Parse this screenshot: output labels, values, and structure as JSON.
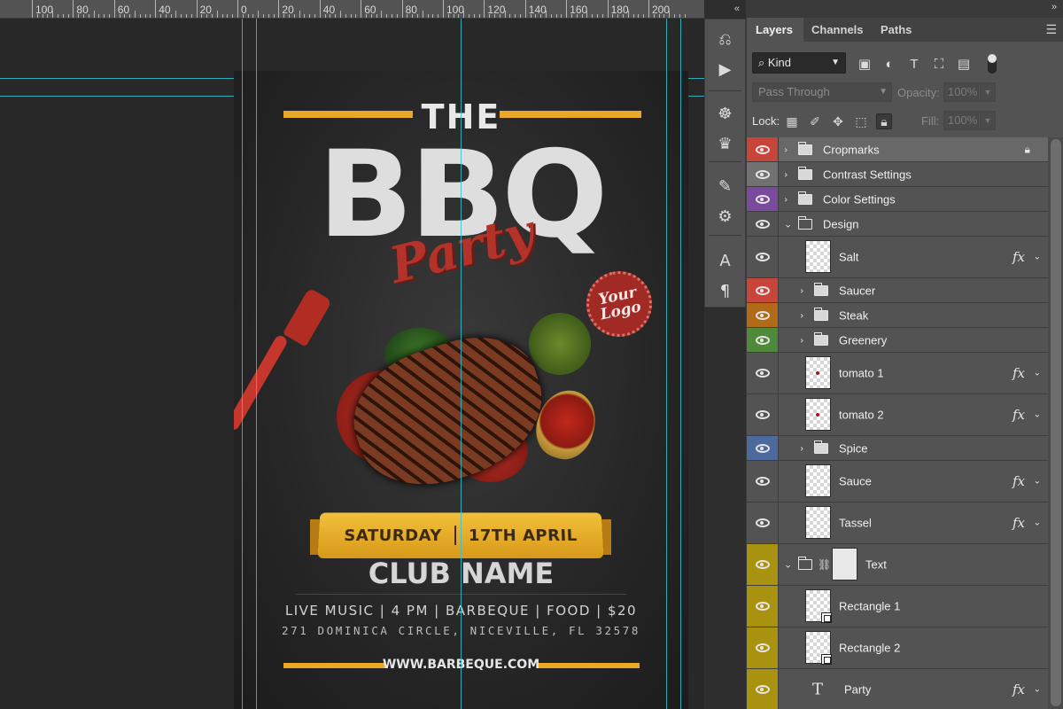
{
  "ruler": {
    "labels": [
      "100",
      "80",
      "60",
      "40",
      "20",
      "0",
      "20",
      "40",
      "60",
      "80",
      "100",
      "120",
      "140",
      "160",
      "180",
      "200"
    ]
  },
  "poster": {
    "title_top": "THE",
    "title_main": "BBQ",
    "title_script": "Party",
    "logo_line1": "Your",
    "logo_line2": "Logo",
    "ribbon_day": "SATURDAY",
    "ribbon_date": "17TH APRIL",
    "club": "CLUB NAME",
    "details": "LIVE MUSIC | 4 PM | BARBEQUE | FOOD | $20",
    "address": "271 DOMINICA CIRCLE, NICEVILLE, FL 32578",
    "website": "WWW.BARBEQUE.COM"
  },
  "strip": {
    "icons": [
      "history-icon",
      "play-icon",
      "wheel-icon",
      "crown-icon",
      "brush-icon",
      "adjust-icon",
      "character-icon",
      "paragraph-icon"
    ]
  },
  "panel": {
    "tabs": [
      {
        "label": "Layers",
        "active": true
      },
      {
        "label": "Channels",
        "active": false
      },
      {
        "label": "Paths",
        "active": false
      }
    ],
    "filter_kind": "Kind",
    "blend_mode": "Pass Through",
    "opacity_label": "Opacity:",
    "opacity_value": "100%",
    "lock_label": "Lock:",
    "fill_label": "Fill:",
    "fill_value": "100%"
  },
  "layers": [
    {
      "name": "Cropmarks",
      "type": "folder",
      "indent": 0,
      "expanded": false,
      "color": "#c8453c",
      "h": 28,
      "locked": true,
      "selected": true
    },
    {
      "name": "Contrast Settings",
      "type": "folder",
      "indent": 0,
      "expanded": false,
      "color": "#717171",
      "h": 28
    },
    {
      "name": "Color Settings",
      "type": "folder",
      "indent": 0,
      "expanded": false,
      "color": "#7a4a9c",
      "h": 28
    },
    {
      "name": "Design",
      "type": "folder",
      "indent": 0,
      "expanded": true,
      "color": "",
      "h": 28
    },
    {
      "name": "Salt",
      "type": "layer",
      "indent": 1,
      "color": "",
      "h": 47,
      "fx": true,
      "thumb": "blank"
    },
    {
      "name": "Saucer",
      "type": "folder",
      "indent": 1,
      "expanded": false,
      "color": "#c8453c",
      "h": 28
    },
    {
      "name": "Steak",
      "type": "folder",
      "indent": 1,
      "expanded": false,
      "color": "#b06a18",
      "h": 28
    },
    {
      "name": "Greenery",
      "type": "folder",
      "indent": 1,
      "expanded": false,
      "color": "#4f8a3a",
      "h": 28
    },
    {
      "name": "tomato 1",
      "type": "layer",
      "indent": 1,
      "color": "",
      "h": 47,
      "fx": true,
      "thumb": "dot"
    },
    {
      "name": "tomato 2",
      "type": "layer",
      "indent": 1,
      "color": "",
      "h": 47,
      "fx": true,
      "thumb": "dot"
    },
    {
      "name": "Spice",
      "type": "folder",
      "indent": 1,
      "expanded": false,
      "color": "#4c6a9e",
      "h": 28
    },
    {
      "name": "Sauce",
      "type": "layer",
      "indent": 1,
      "color": "",
      "h": 47,
      "fx": true,
      "thumb": "blank"
    },
    {
      "name": "Tassel",
      "type": "layer",
      "indent": 1,
      "color": "",
      "h": 47,
      "fx": true,
      "thumb": "blank"
    },
    {
      "name": "Text",
      "type": "maskfolder",
      "indent": 0,
      "expanded": true,
      "color": "#a8920f",
      "h": 47
    },
    {
      "name": "Rectangle 1",
      "type": "layer",
      "indent": 1,
      "color": "#a8920f",
      "h": 47,
      "thumb": "vector"
    },
    {
      "name": "Rectangle 2",
      "type": "layer",
      "indent": 1,
      "color": "#a8920f",
      "h": 47,
      "thumb": "vector"
    },
    {
      "name": "Party",
      "type": "text",
      "indent": 1,
      "color": "#a8920f",
      "h": 47,
      "fx": true
    }
  ]
}
